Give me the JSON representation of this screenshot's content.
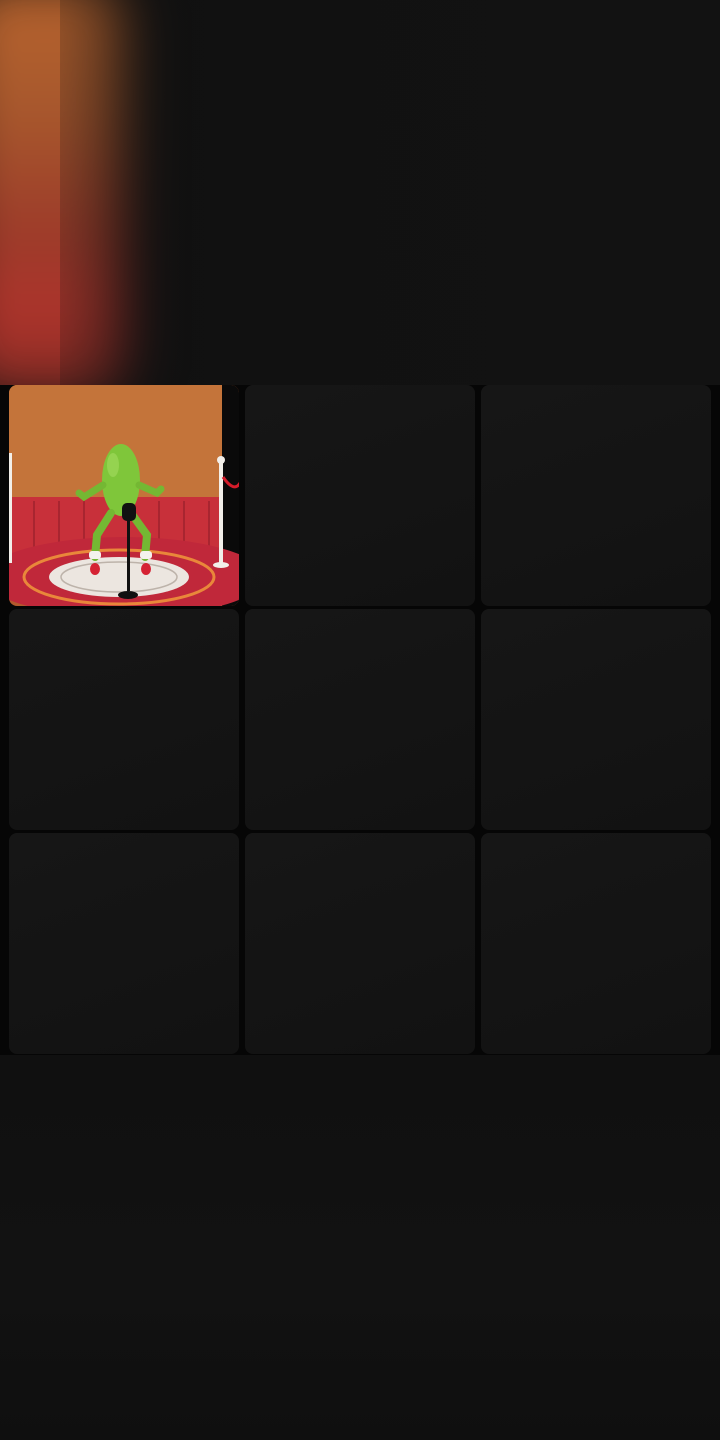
{
  "screen": {
    "background_color": "#0e0e0e",
    "grid_band_color": "#060606",
    "tile_color": "#141414"
  },
  "top_preview": {
    "description_icon": "blurred-video-preview"
  },
  "grid": {
    "rows": 3,
    "columns": 3,
    "tiles": [
      {
        "id": "tile-1",
        "content": "dancing-pickle-video-thumbnail",
        "selected": true
      },
      {
        "id": "tile-2",
        "content": "empty"
      },
      {
        "id": "tile-3",
        "content": "empty"
      },
      {
        "id": "tile-4",
        "content": "empty"
      },
      {
        "id": "tile-5",
        "content": "empty"
      },
      {
        "id": "tile-6",
        "content": "empty"
      },
      {
        "id": "tile-7",
        "content": "empty"
      },
      {
        "id": "tile-8",
        "content": "empty"
      },
      {
        "id": "tile-9",
        "content": "empty"
      }
    ]
  },
  "thumbnail_colors": {
    "wall": "#c9783c",
    "floor": "#c9303a",
    "pickle": "#7cc23a",
    "microphone": "#111111"
  }
}
